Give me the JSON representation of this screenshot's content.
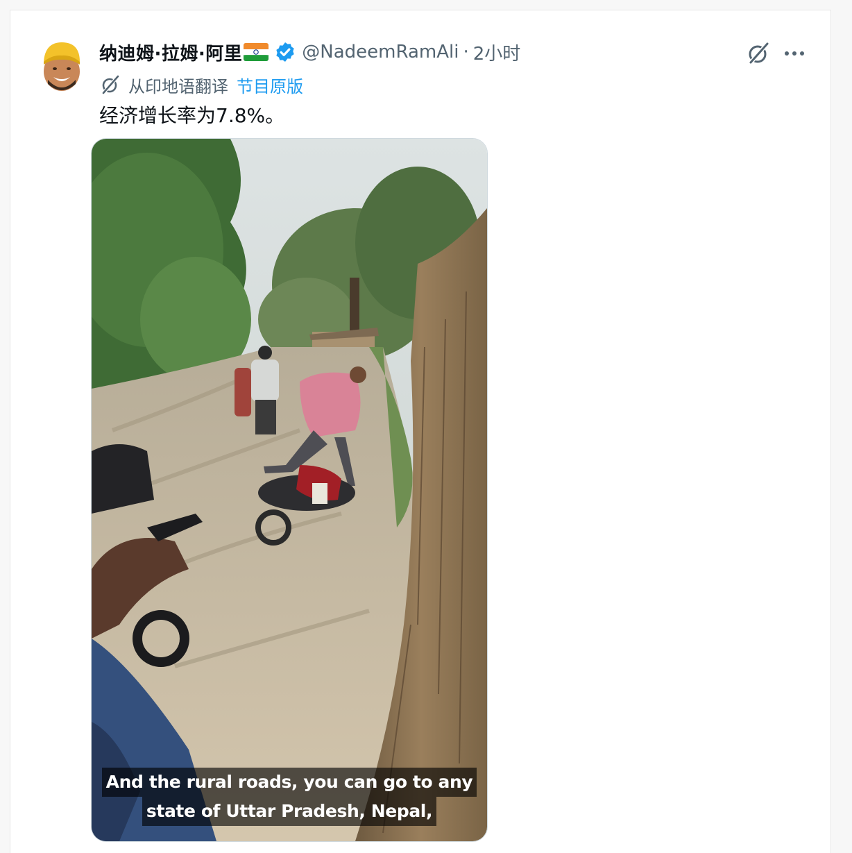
{
  "author": {
    "display_name": "纳迪姆·拉姆·阿里",
    "flag": "india-flag",
    "verified": true,
    "handle": "@NadeemRamAli",
    "separator": "·",
    "time": "2小时"
  },
  "translation": {
    "label": "从印地语翻译",
    "show_original": "节目原版"
  },
  "tweet": {
    "text": "经济增长率为7.8%。"
  },
  "media": {
    "type": "video",
    "subtitle_line1": "And the rural roads, you can go to any",
    "subtitle_line2": "state of Uttar Pradesh, Nepal,"
  },
  "actions": {
    "grok_icon": "grok-icon",
    "more_icon": "more-icon"
  },
  "colors": {
    "verified": "#1d9bf0",
    "link": "#1d9bf0",
    "secondary_text": "#536471",
    "primary_text": "#0f1419"
  }
}
